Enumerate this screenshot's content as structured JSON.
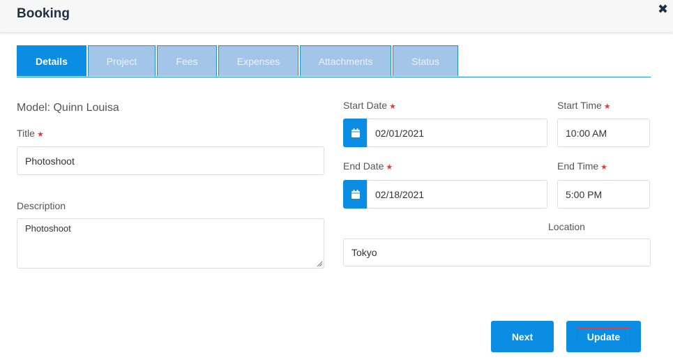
{
  "dialog": {
    "title": "Booking"
  },
  "tabs": [
    {
      "label": "Details",
      "active": true
    },
    {
      "label": "Project",
      "active": false
    },
    {
      "label": "Fees",
      "active": false
    },
    {
      "label": "Expenses",
      "active": false
    },
    {
      "label": "Attachments",
      "active": false
    },
    {
      "label": "Status",
      "active": false
    }
  ],
  "form": {
    "model_label": "Model: Quinn Louisa",
    "title_label": "Title",
    "title_value": "Photoshoot",
    "description_label": "Description",
    "description_value": "Photoshoot",
    "start_date_label": "Start Date",
    "start_date_value": "02/01/2021",
    "start_time_label": "Start Time",
    "start_time_value": "10:00 AM",
    "end_date_label": "End Date",
    "end_date_value": "02/18/2021",
    "end_time_label": "End Time",
    "end_time_value": "5:00 PM",
    "location_label": "Location",
    "location_value": "Tokyo",
    "required_marker": "★"
  },
  "actions": {
    "next_label": "Next",
    "update_label": "Update"
  },
  "colors": {
    "accent": "#0b8de4",
    "tab_inactive": "#a3c6e8",
    "required": "#e53935",
    "title": "#1f3044"
  }
}
